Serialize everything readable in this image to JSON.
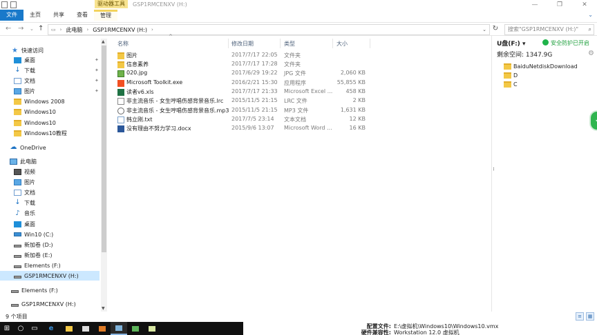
{
  "window": {
    "title": "GSP1RMCENXV (H:)",
    "context_tab": "驱动器工具",
    "controls": [
      "—",
      "❐",
      "✕"
    ]
  },
  "ribbon": {
    "tabs": [
      "文件",
      "主页",
      "共享",
      "查看",
      "管理"
    ],
    "expand_icon": "chevron-down-icon"
  },
  "address": {
    "crumbs": [
      "此电脑",
      "GSP1RMCENXV (H:)"
    ],
    "search_placeholder": "搜索\"GSP1RMCENXV (H:)\""
  },
  "sidebar": {
    "quick_access": "快速访问",
    "quick_items": [
      "桌面",
      "下载",
      "文档",
      "图片",
      "Windows 2008",
      "Windows10",
      "Windows10",
      "Windows10教程"
    ],
    "onedrive": "OneDrive",
    "this_pc": "此电脑",
    "pc_items": [
      "视频",
      "图片",
      "文档",
      "下载",
      "音乐",
      "桌面",
      "Win10 (C:)",
      "新加卷 (D:)",
      "新加卷 (E:)",
      "Elements (F:)",
      "GSP1RMCENXV (H:)"
    ],
    "extra_items": [
      "Elements (F:)",
      "GSP1RMCENXV (H:)"
    ]
  },
  "columns": {
    "name": "名称",
    "date": "修改日期",
    "type": "类型",
    "size": "大小"
  },
  "files": [
    {
      "name": "图片",
      "date": "2017/7/17 22:05",
      "type": "文件夹",
      "size": "",
      "icon": "folder"
    },
    {
      "name": "信息素养",
      "date": "2017/7/17 17:28",
      "type": "文件夹",
      "size": "",
      "icon": "folder"
    },
    {
      "name": "020.jpg",
      "date": "2017/6/29 19:22",
      "type": "JPG 文件",
      "size": "2,060 KB",
      "icon": "jpg"
    },
    {
      "name": "Microsoft Toolkit.exe",
      "date": "2016/2/21 15:30",
      "type": "应用程序",
      "size": "55,855 KB",
      "icon": "exe"
    },
    {
      "name": "读者v6.xls",
      "date": "2017/7/17 21:33",
      "type": "Microsoft Excel ...",
      "size": "458 KB",
      "icon": "xls"
    },
    {
      "name": "非主流音乐 - 女生哼唱伤感背景音乐.lrc",
      "date": "2015/11/5 21:15",
      "type": "LRC 文件",
      "size": "2 KB",
      "icon": "lrc"
    },
    {
      "name": "非主流音乐 - 女生哼唱伤感背景音乐.mp3",
      "date": "2015/11/5 21:15",
      "type": "MP3 文件",
      "size": "1,631 KB",
      "icon": "mp3"
    },
    {
      "name": "韩立刚.txt",
      "date": "2017/7/5 23:14",
      "type": "文本文档",
      "size": "12 KB",
      "icon": "txt"
    },
    {
      "name": "没有理由不努力学习.docx",
      "date": "2015/9/6 13:07",
      "type": "Microsoft Word ...",
      "size": "16 KB",
      "icon": "docx"
    }
  ],
  "right_pane": {
    "drive": "U盘(F:)",
    "safe_label": "安全防护已开启",
    "free_label": "剩余空间: 1347.9G",
    "folders": [
      "BaiduNetdiskDownload",
      "D",
      "C"
    ]
  },
  "status": {
    "count": "9 个项目"
  },
  "vm_info": {
    "config_label": "配置文件:",
    "config_value": "E:\\虚拟机\\Windows10\\Windows10.vmx",
    "hw_label": "硬件兼容性:",
    "hw_value": "Workstation 12.0 虚拟机"
  },
  "colors": {
    "file_tab": "#1979ca",
    "selection": "#cce8ff",
    "context_tab": "#f8e38f",
    "safe_green": "#1fb34a"
  }
}
